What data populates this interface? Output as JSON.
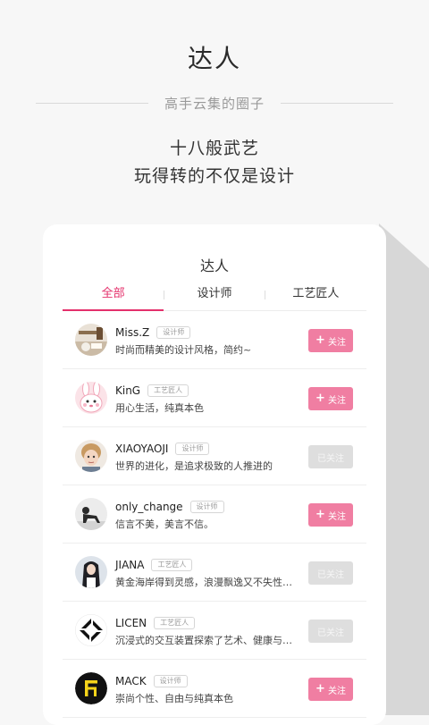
{
  "header": {
    "title": "达人",
    "subtitle": "高手云集的圈子",
    "slogan_line1": "十八般武艺",
    "slogan_line2": "玩得转的不仅是设计"
  },
  "card": {
    "title": "达人",
    "tabs": [
      {
        "label": "全部",
        "active": true
      },
      {
        "label": "设计师",
        "active": false
      },
      {
        "label": "工艺匠人",
        "active": false
      }
    ]
  },
  "users": [
    {
      "name": "Miss.Z",
      "tag": "设计师",
      "desc": "时尚而精美的设计风格，简约~",
      "follow_label": "关注",
      "followed": false,
      "avatar_icon": "bedroom-photo-avatar"
    },
    {
      "name": "KinG",
      "tag": "工艺匠人",
      "desc": "用心生活，纯真本色",
      "follow_label": "关注",
      "followed": false,
      "avatar_icon": "pink-rabbit-avatar"
    },
    {
      "name": "XIAOYAOJI",
      "tag": "设计师",
      "desc": "世界的进化，是追求极致的人推进的",
      "follow_label": "已关注",
      "followed": true,
      "avatar_icon": "child-portrait-avatar"
    },
    {
      "name": "only_change",
      "tag": "设计师",
      "desc": "信言不美，美言不信。",
      "follow_label": "关注",
      "followed": false,
      "avatar_icon": "silhouette-avatar"
    },
    {
      "name": "JIANA",
      "tag": "工艺匠人",
      "desc": "黄金海岸得到灵感，浪漫飘逸又不失性感...",
      "follow_label": "已关注",
      "followed": true,
      "avatar_icon": "long-hair-woman-avatar"
    },
    {
      "name": "LICEN",
      "tag": "工艺匠人",
      "desc": "沉浸式的交互装置探索了艺术、健康与人...",
      "follow_label": "已关注",
      "followed": true,
      "avatar_icon": "geometric-logo-avatar"
    },
    {
      "name": "MACK",
      "tag": "设计师",
      "desc": "崇尚个性、自由与纯真本色",
      "follow_label": "关注",
      "followed": false,
      "avatar_icon": "yellow-f-logo-avatar"
    }
  ],
  "colors": {
    "accent": "#e4306b",
    "follow_pink": "#f07ea2",
    "followed_gray": "#dedede"
  }
}
